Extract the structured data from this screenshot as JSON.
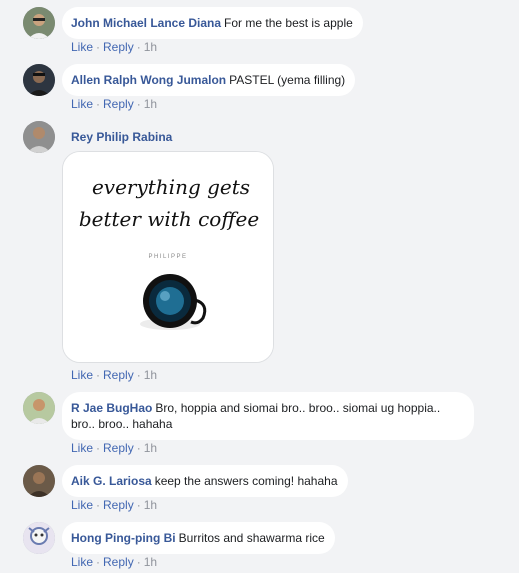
{
  "comments": [
    {
      "author": "John Michael Lance Diana",
      "text": "For me the best is apple",
      "actions": {
        "like": "Like",
        "reply": "Reply",
        "time": "1h"
      }
    },
    {
      "author": "Allen Ralph Wong Jumalon",
      "text": "PASTEL (yema filling)",
      "actions": {
        "like": "Like",
        "reply": "Reply",
        "time": "1h"
      }
    },
    {
      "author": "Rey Philip Rabina",
      "text": "",
      "image": {
        "line1": "everything gets",
        "line2": "better with coffee",
        "brand": "PHILIPPE"
      },
      "actions": {
        "like": "Like",
        "reply": "Reply",
        "time": "1h"
      }
    },
    {
      "author": "R Jae BugHao",
      "text": "Bro, hoppia and siomai bro.. broo.. siomai ug hoppia.. bro.. broo.. hahaha",
      "actions": {
        "like": "Like",
        "reply": "Reply",
        "time": "1h"
      }
    },
    {
      "author": "Aik G. Lariosa",
      "text": "keep the answers coming! hahaha",
      "actions": {
        "like": "Like",
        "reply": "Reply",
        "time": "1h"
      }
    },
    {
      "author": "Hong Ping-ping Bi",
      "text": "Burritos and shawarma rice",
      "actions": {
        "like": "Like",
        "reply": "Reply",
        "time": "1h"
      }
    }
  ],
  "separator": "·"
}
